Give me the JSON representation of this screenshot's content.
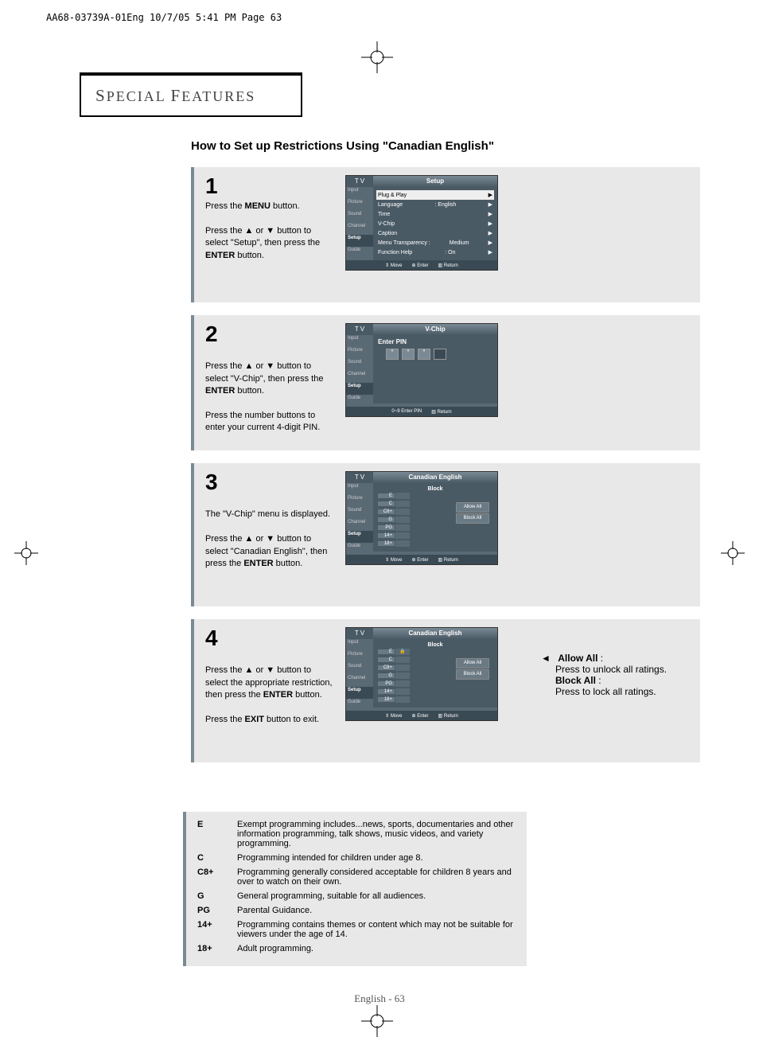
{
  "doc_header": "AA68-03739A-01Eng  10/7/05  5:41 PM  Page 63",
  "section_title_pre": "S",
  "section_title_rest": "PECIAL ",
  "section_title_pre2": "F",
  "section_title_rest2": "EATURES",
  "subtitle": "How to Set up Restrictions Using \"Canadian English\"",
  "steps": [
    {
      "num": "1",
      "text_parts": [
        "Press the ",
        "MENU",
        " button.\n\nPress the ▲ or ▼ button to select \"Setup\", then press the ",
        "ENTER",
        " button."
      ]
    },
    {
      "num": "2",
      "text_parts": [
        "Press the ▲ or ▼ button to select \"V-Chip\", then press the ",
        "ENTER",
        " button.\n\nPress the number buttons to enter your current 4-digit PIN."
      ]
    },
    {
      "num": "3",
      "text_parts": [
        "The \"V-Chip\" menu is displayed.\n\nPress the ▲ or ▼ button to select \"Canadian English\", then press the ",
        "ENTER",
        " button."
      ]
    },
    {
      "num": "4",
      "text_parts": [
        "Press the ▲ or ▼ button to select the appropriate restriction, then press  the ",
        "ENTER",
        " button.\n\nPress the ",
        "EXIT",
        " button to exit."
      ]
    }
  ],
  "tv": {
    "tv_label": "T V",
    "side_items": [
      "Input",
      "Picture",
      "Sound",
      "Channel",
      "Setup",
      "Guide"
    ],
    "setup": {
      "title": "Setup",
      "rows": [
        {
          "l": "Plug & Play",
          "r": "",
          "hl": true
        },
        {
          "l": "Language",
          "r": ":   English"
        },
        {
          "l": "Time",
          "r": ""
        },
        {
          "l": "V-Chip",
          "r": ""
        },
        {
          "l": "Caption",
          "r": ""
        },
        {
          "l": "Menu Transparency :",
          "r": "Medium"
        },
        {
          "l": "Function Help",
          "r": ":   On"
        }
      ],
      "footer": [
        "Move",
        "Enter",
        "Return"
      ]
    },
    "vchip": {
      "title": "V-Chip",
      "enter_pin": "Enter PIN",
      "footer": [
        "0~9  Enter PIN",
        "Return"
      ]
    },
    "canadian": {
      "title": "Canadian English",
      "block": "Block",
      "ratings": [
        "E",
        "C",
        "C8+",
        "G",
        "PG",
        "14+",
        "18+"
      ],
      "allow_all": "Allow All",
      "block_all": "Block All",
      "footer": [
        "Move",
        "Enter",
        "Return"
      ]
    }
  },
  "side_note": {
    "allow_label": "Allow All",
    "allow_sep": " :",
    "allow_desc": "Press to unlock all ratings.",
    "block_label": "Block All",
    "block_sep": " :",
    "block_desc": "Press to lock all ratings."
  },
  "defs": [
    {
      "code": "E",
      "text": "Exempt programming includes...news, sports, documentaries and other information programming, talk shows, music videos, and variety programming."
    },
    {
      "code": "C",
      "text": "Programming intended for children under age 8."
    },
    {
      "code": "C8+",
      "text": "Programming generally considered acceptable for children 8 years and over to watch on their own."
    },
    {
      "code": "G",
      "text": "General programming, suitable for all audiences."
    },
    {
      "code": "PG",
      "text": "Parental Guidance."
    },
    {
      "code": "14+",
      "text": "Programming contains themes or content which may not be suitable for viewers under the age of 14."
    },
    {
      "code": "18+",
      "text": "Adult programming."
    }
  ],
  "page_num": "English - 63"
}
